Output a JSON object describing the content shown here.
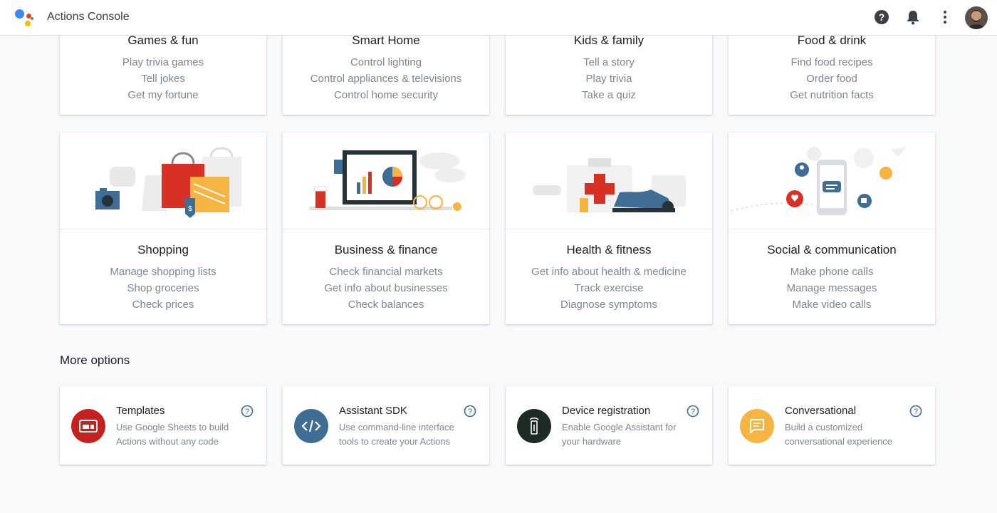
{
  "app": {
    "title": "Actions Console"
  },
  "topbar": {
    "help_icon": "help-circle-icon",
    "notifications_icon": "bell-icon",
    "more_icon": "more-vert-icon",
    "avatar_icon": "user-avatar"
  },
  "categories_top": [
    {
      "title": "Games & fun",
      "items": [
        "Play trivia games",
        "Tell jokes",
        "Get my fortune"
      ]
    },
    {
      "title": "Smart Home",
      "items": [
        "Control lighting",
        "Control appliances & televisions",
        "Control home security"
      ]
    },
    {
      "title": "Kids & family",
      "items": [
        "Tell a story",
        "Play trivia",
        "Take a quiz"
      ]
    },
    {
      "title": "Food & drink",
      "items": [
        "Find food recipes",
        "Order food",
        "Get nutrition facts"
      ]
    }
  ],
  "categories_bottom": [
    {
      "title": "Shopping",
      "items": [
        "Manage shopping lists",
        "Shop groceries",
        "Check prices"
      ],
      "illustration": "shopping-bags"
    },
    {
      "title": "Business & finance",
      "items": [
        "Check financial markets",
        "Get info about businesses",
        "Check balances"
      ],
      "illustration": "laptop-charts"
    },
    {
      "title": "Health & fitness",
      "items": [
        "Get info about health & medicine",
        "Track exercise",
        "Diagnose symptoms"
      ],
      "illustration": "first-aid-sneaker"
    },
    {
      "title": "Social & communication",
      "items": [
        "Make phone calls",
        "Manage messages",
        "Make video calls"
      ],
      "illustration": "phone-messages"
    }
  ],
  "more_options": {
    "heading": "More options",
    "cards": [
      {
        "title": "Templates",
        "description": "Use Google Sheets to build Actions without any code",
        "icon": "templates-icon",
        "color": "#c5221f"
      },
      {
        "title": "Assistant SDK",
        "description": "Use command-line interface tools to create your Actions",
        "icon": "code-icon",
        "color": "#3f6d94"
      },
      {
        "title": "Device registration",
        "description": "Enable Google Assistant for your hardware",
        "icon": "device-icon",
        "color": "#1e2a24"
      },
      {
        "title": "Conversational",
        "description": "Build a customized conversational experience",
        "icon": "chat-icon",
        "color": "#f6b443"
      }
    ]
  },
  "colors": {
    "accent_blue": "#4285f4",
    "accent_red": "#ea4335",
    "accent_yellow": "#fbbc04",
    "accent_green": "#34a853"
  }
}
